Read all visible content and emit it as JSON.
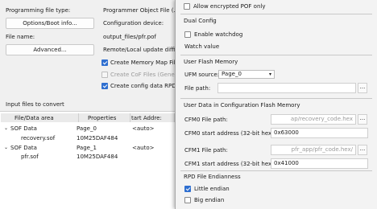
{
  "left": {
    "programming_file_type_label": "Programming file type:",
    "programming_file_type_value": "Programmer Object File (.po",
    "options_boot_button": "Options/Boot info...",
    "configuration_device_label": "Configuration device:",
    "file_name_label": "File name:",
    "file_name_value": "output_files/pfr.pof",
    "advanced_button": "Advanced...",
    "remote_local_label": "Remote/Local update difficu",
    "create_memory_map": "Create Memory Map File",
    "create_cof": "Create CoF Files (Generat",
    "create_config_rpd": "Create config data RPD (",
    "input_files_title": "Input files to convert",
    "columns": [
      "File/Data area",
      "Properties",
      "tart Addre:"
    ],
    "rows": [
      {
        "name": "SOF Data",
        "props": "Page_0",
        "addr": "<auto>",
        "expand": "⌄"
      },
      {
        "name": "recovery.sof",
        "props": "10M25DAF484",
        "addr": "",
        "expand": ""
      },
      {
        "name": "SOF Data",
        "props": "Page_1",
        "addr": "<auto>",
        "expand": "⌄"
      },
      {
        "name": "pfr.sof",
        "props": "10M25DAF484",
        "addr": "",
        "expand": ""
      }
    ]
  },
  "dialog": {
    "allow_encrypted_pof": "Allow encrypted POF only",
    "dual_config_title": "Dual Config",
    "enable_watchdog": "Enable watchdog",
    "watch_value_label": "Watch value",
    "ufm_title": "User Flash Memory",
    "ufm_source_label": "UFM source:",
    "ufm_source_value": "Page_0",
    "file_path_label": "File path:",
    "file_path_value": "",
    "cfm_title": "User Data in Configuration Flash Memory",
    "cfm0_file_path_label": "CFM0 File path:",
    "cfm0_file_path_value": "ap/recovery_code.hex",
    "cfm0_start_label": "CFM0 start address (32-bit hexadecimal):",
    "cfm0_start_value": "0x63000",
    "cfm1_file_path_label": "CFM1 File path:",
    "cfm1_file_path_value": "/pfr_app/pfr_code.hex",
    "cfm1_start_label": "CFM1 start address (32-bit hexadecimal):",
    "cfm1_start_value": "0x41000",
    "endianness_title": "RPD File Endianness",
    "little_endian": "Little endian",
    "big_endian": "Big endian",
    "browse_glyph": "..."
  },
  "colors": {
    "accent": "#2f6fd0",
    "field_bg": "#ffffff",
    "window_bg": "#f0f0f0"
  }
}
